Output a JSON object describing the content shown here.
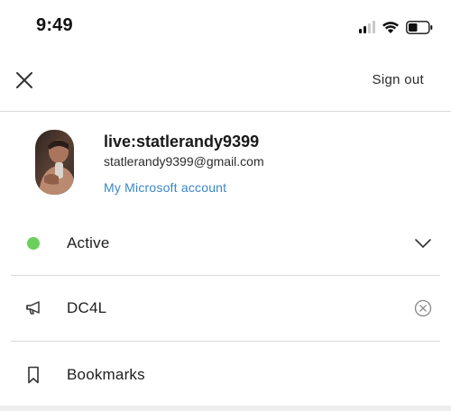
{
  "status_bar": {
    "time": "9:49",
    "signal_icon": "cellular-signal-icon",
    "wifi_icon": "wifi-icon",
    "battery_icon": "battery-icon",
    "battery_level": 0.45
  },
  "header": {
    "close_icon": "close-icon",
    "sign_out_label": "Sign out"
  },
  "profile": {
    "username": "live:statlerandy9399",
    "email": "statlerandy9399@gmail.com",
    "account_link": "My Microsoft account"
  },
  "menu": {
    "status": {
      "label": "Active",
      "icon": "status-dot-icon",
      "color": "#6ccf5b",
      "trailing_icon": "chevron-down-icon"
    },
    "mood": {
      "label": "DC4L",
      "icon": "megaphone-icon",
      "trailing_icon": "clear-icon"
    },
    "bookmarks": {
      "label": "Bookmarks",
      "icon": "bookmark-icon"
    }
  },
  "colors": {
    "link": "#3a87c8",
    "active_green": "#6ccf5b",
    "divider": "#d9d9d9"
  }
}
